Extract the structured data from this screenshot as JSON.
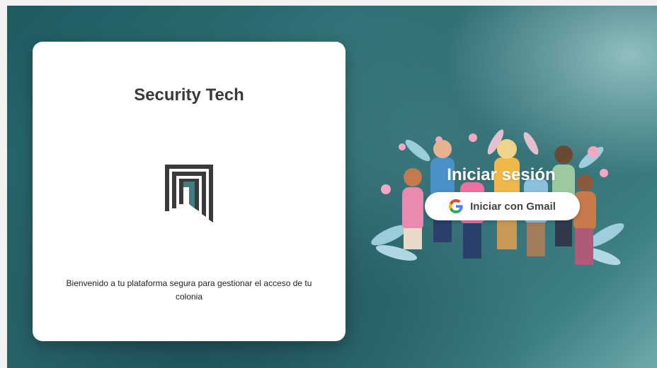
{
  "card": {
    "title": "Security Tech",
    "welcome_text": "Bienvenido a tu plataforma segura para gestionar el acceso de tu colonia"
  },
  "login": {
    "title": "Iniciar sesión",
    "gmail_button_label": "Iniciar con Gmail"
  },
  "icons": {
    "logo": "security-tech-logo",
    "google": "google-icon",
    "illustration": "people-group-illustration"
  },
  "colors": {
    "background_teal": "#2c686e",
    "logo_dark": "#3a3a3a",
    "logo_accent": "#3f7d7e",
    "card": "#ffffff"
  }
}
